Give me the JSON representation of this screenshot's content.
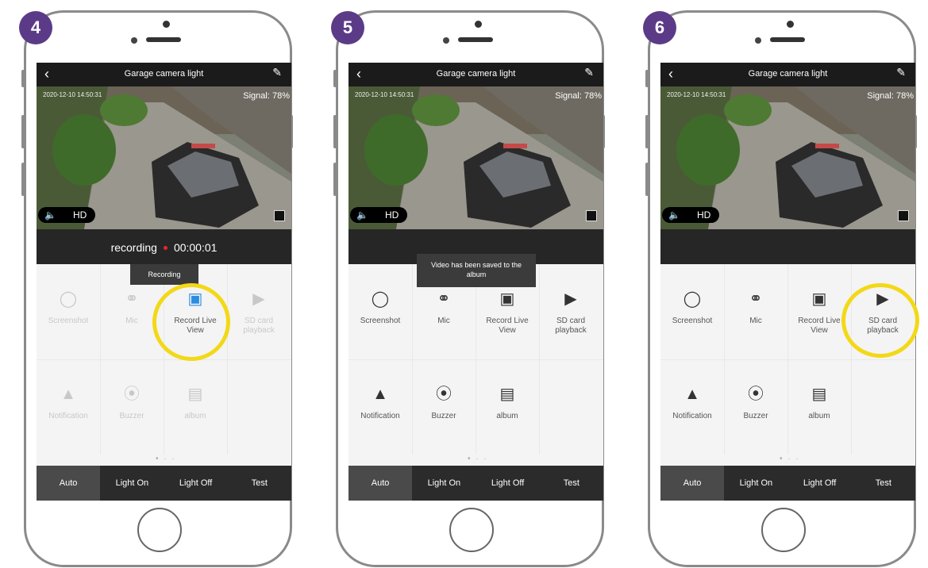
{
  "phones": [
    {
      "step": "4",
      "app": {
        "title": "Garage camera light",
        "back_icon": "chevron-left-icon",
        "edit_icon": "pencil-icon"
      },
      "video": {
        "timestamp": "2020-12-10 14:50:31",
        "signal": "Signal: 78%",
        "hd_label": "HD",
        "speaker_icon": "speaker-mute-icon",
        "fullscreen_icon": "fullscreen-icon"
      },
      "status": {
        "recording_label": "recording",
        "recording_time": "00:00:01"
      },
      "toast": "Recording",
      "controls": [
        {
          "label": "Screenshot",
          "icon": "camera-icon"
        },
        {
          "label": "Mic",
          "icon": "microphone-icon"
        },
        {
          "label": "Record Live View",
          "icon": "video-camera-icon"
        },
        {
          "label": "SD card playback",
          "icon": "playback-icon"
        },
        {
          "label": "Notification",
          "icon": "siren-icon"
        },
        {
          "label": "Buzzer",
          "icon": "buzzer-icon"
        },
        {
          "label": "album",
          "icon": "image-icon"
        }
      ],
      "pager": "• · ·",
      "bottom_bar": [
        "Auto",
        "Light On",
        "Light Off",
        "Test"
      ],
      "active_tab": "Auto",
      "highlight_color": "#f3d817"
    },
    {
      "step": "5",
      "app": {
        "title": "Garage camera light"
      },
      "video": {
        "timestamp": "2020-12-10 14:50:31",
        "signal": "Signal: 78%",
        "hd_label": "HD"
      },
      "toast": "Video has been saved to the album",
      "controls": [
        {
          "label": "Screenshot",
          "icon": "camera-icon"
        },
        {
          "label": "Mic",
          "icon": "microphone-icon"
        },
        {
          "label": "Record Live View",
          "icon": "video-camera-icon"
        },
        {
          "label": "SD card playback",
          "icon": "playback-icon"
        },
        {
          "label": "Notification",
          "icon": "siren-icon"
        },
        {
          "label": "Buzzer",
          "icon": "buzzer-icon"
        },
        {
          "label": "album",
          "icon": "image-icon"
        }
      ],
      "pager": "• · ·",
      "bottom_bar": [
        "Auto",
        "Light On",
        "Light Off",
        "Test"
      ],
      "active_tab": "Auto"
    },
    {
      "step": "6",
      "app": {
        "title": "Garage camera light"
      },
      "video": {
        "timestamp": "2020-12-10 14:50:31",
        "signal": "Signal: 78%",
        "hd_label": "HD"
      },
      "controls": [
        {
          "label": "Screenshot",
          "icon": "camera-icon"
        },
        {
          "label": "Mic",
          "icon": "microphone-icon"
        },
        {
          "label": "Record Live View",
          "icon": "video-camera-icon"
        },
        {
          "label": "SD card playback",
          "icon": "playback-icon"
        },
        {
          "label": "Notification",
          "icon": "siren-icon"
        },
        {
          "label": "Buzzer",
          "icon": "buzzer-icon"
        },
        {
          "label": "album",
          "icon": "image-icon"
        }
      ],
      "pager": "• · ·",
      "bottom_bar": [
        "Auto",
        "Light On",
        "Light Off",
        "Test"
      ],
      "active_tab": "Auto",
      "highlight_color": "#f3d817"
    }
  ]
}
